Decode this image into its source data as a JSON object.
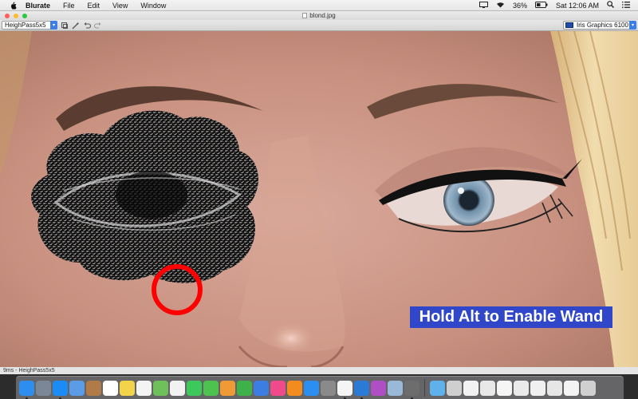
{
  "menubar": {
    "app_name": "Blurate",
    "items": [
      "File",
      "Edit",
      "View",
      "Window"
    ],
    "battery": "36%",
    "clock": "Sat 12:06 AM"
  },
  "window": {
    "title": "blond.jpg"
  },
  "toolbar": {
    "filter_select": "HeighPass5x5",
    "gpu_select": "Iris Graphics 6100"
  },
  "canvas": {
    "overlay_text": "Hold Alt to Enable Wand"
  },
  "statusbar": {
    "text": "9ms - HeighPass5x5"
  },
  "dock": {
    "icons": [
      {
        "name": "finder-icon",
        "color": "#2d8ef0",
        "running": true
      },
      {
        "name": "launchpad-icon",
        "color": "#7b8797",
        "running": false
      },
      {
        "name": "safari-icon",
        "color": "#1b8cf5",
        "running": true
      },
      {
        "name": "mail-icon",
        "color": "#5c9be6",
        "running": false
      },
      {
        "name": "contacts-icon",
        "color": "#b07b46",
        "running": false
      },
      {
        "name": "calendar-icon",
        "color": "#ffffff",
        "running": false
      },
      {
        "name": "notes-icon",
        "color": "#f3d34a",
        "running": false
      },
      {
        "name": "reminders-icon",
        "color": "#f4f4f4",
        "running": false
      },
      {
        "name": "maps-icon",
        "color": "#6fbf5a",
        "running": false
      },
      {
        "name": "photos-icon",
        "color": "#f2f2f2",
        "running": false
      },
      {
        "name": "messages-icon",
        "color": "#3cc85a",
        "running": false
      },
      {
        "name": "facetime-icon",
        "color": "#4ec24e",
        "running": false
      },
      {
        "name": "pages-icon",
        "color": "#f09a35",
        "running": false
      },
      {
        "name": "numbers-icon",
        "color": "#3fb14a",
        "running": false
      },
      {
        "name": "keynote-icon",
        "color": "#3b7de0",
        "running": false
      },
      {
        "name": "music-icon",
        "color": "#f04a8a",
        "running": false
      },
      {
        "name": "ibooks-icon",
        "color": "#f28c1e",
        "running": false
      },
      {
        "name": "app-store-icon",
        "color": "#2a8ff0",
        "running": false
      },
      {
        "name": "system-preferences-icon",
        "color": "#8a8a8a",
        "running": false
      },
      {
        "name": "textedit-icon",
        "color": "#f5f5f5",
        "running": true
      },
      {
        "name": "xcode-icon",
        "color": "#2a7ad6",
        "running": true
      },
      {
        "name": "instruments-icon",
        "color": "#b04fc4",
        "running": false
      },
      {
        "name": "preview-icon",
        "color": "#9ab8d8",
        "running": false
      },
      {
        "name": "blurate-icon",
        "color": "#6d6d6d",
        "running": true
      }
    ],
    "stacks": [
      {
        "name": "folder-icon",
        "color": "#5fb1ec"
      },
      {
        "name": "calculator-icon",
        "color": "#cfcfcf"
      },
      {
        "name": "document-stack-icon",
        "color": "#f2f2f2"
      },
      {
        "name": "document-stack-icon",
        "color": "#e8e8e8"
      },
      {
        "name": "document-stack-icon",
        "color": "#f5f5f5"
      },
      {
        "name": "document-stack-icon",
        "color": "#eaeaea"
      },
      {
        "name": "document-stack-icon",
        "color": "#f0f0f0"
      },
      {
        "name": "document-stack-icon",
        "color": "#e6e6e6"
      },
      {
        "name": "document-stack-icon",
        "color": "#f3f3f3"
      },
      {
        "name": "trash-icon",
        "color": "#d0d0d0"
      }
    ]
  }
}
